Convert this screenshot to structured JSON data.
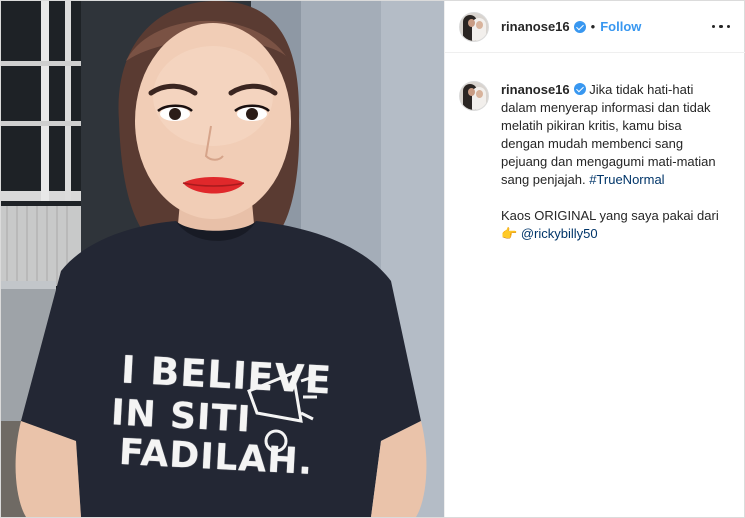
{
  "post": {
    "username": "rinanose16",
    "separator": "•",
    "follow_label": "Follow",
    "photo": {
      "shirt_lines": [
        "I BELIEVE",
        "IN SITI",
        "FADILAH."
      ]
    },
    "caption": {
      "username": "rinanose16",
      "text": "Jika tidak hati-hati dalam menyerap informasi dan tidak melatih pikiran kritis, kamu bisa dengan mudah membenci sang pejuang dan mengagumi mati-matian sang penjajah.",
      "hashtag": "#TrueNormal",
      "credit_text": "Kaos ORIGINAL yang saya pakai dari",
      "pointing_emoji": "👉",
      "mention": "@rickybilly50"
    }
  },
  "colors": {
    "accent": "#3897f0",
    "link": "#003569",
    "text": "#262626",
    "border": "#dbdbdb"
  },
  "icons": {
    "verified": "verified-badge-icon",
    "more": "more-options-icon"
  }
}
